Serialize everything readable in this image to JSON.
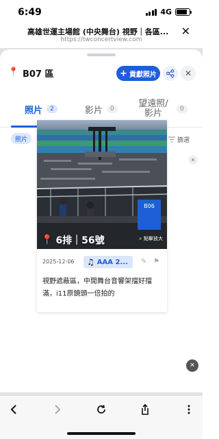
{
  "status": {
    "time": "6:49",
    "network": "4G",
    "battery_level": 0.85
  },
  "browser": {
    "title": "高雄世運主場館 (中央舞台) 視野｜各區...",
    "url": "https://twconcertview.com",
    "close_icon": "close-icon"
  },
  "panel": {
    "zone": "B07 區",
    "contribute_label": "貢獻照片",
    "tabs": [
      {
        "label": "照片",
        "count": "2"
      },
      {
        "label": "影片",
        "count": "0"
      },
      {
        "label": "望遠照/影片",
        "count": "0"
      }
    ],
    "filter_chip": "照片",
    "dot": "·",
    "count_prefix": "已篩",
    "count_value": "2",
    "count_suffix": "筆",
    "filter_label": "篩選"
  },
  "card": {
    "seat": "6排｜56號",
    "zoom_label": "點擊放大",
    "sign_text": "B06",
    "date": "2025-12-06",
    "song": "AAA 2...",
    "description": "視野遮蔽區，中間舞台音響架擋好擋滿，i11原鏡頭一倍拍的"
  },
  "colors": {
    "accent": "#1d5fd6",
    "chip_bg": "#dbe6fb"
  }
}
